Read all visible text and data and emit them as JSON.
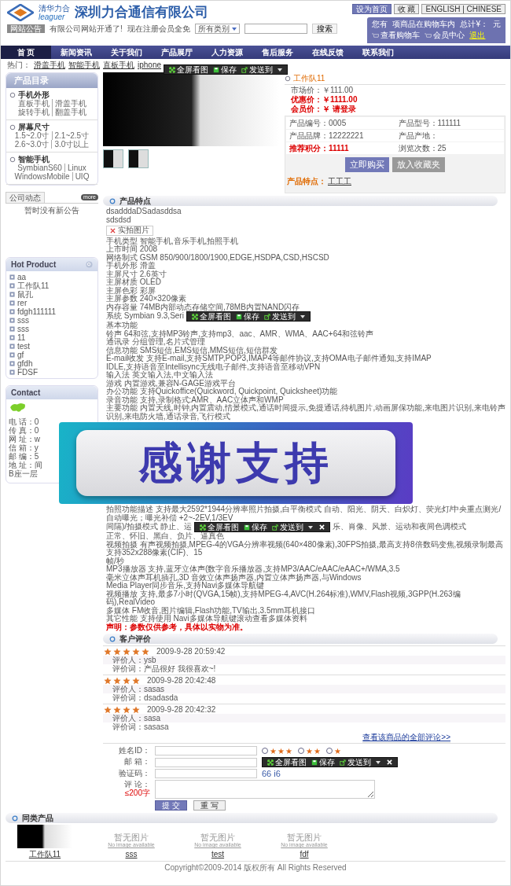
{
  "header": {
    "logo_cn": "清华力合",
    "logo_latin": "leaguer",
    "company_name": "深圳力合通信有限公司",
    "top_links": [
      "设为首页",
      "收 藏",
      "ENGLISH | CHINESE"
    ]
  },
  "notice_bar": {
    "tag": "网站公告",
    "notice": "有限公司网站开通了!",
    "register": "现在注册会员全免",
    "category_select": "所有类别",
    "search_button": "搜索"
  },
  "cart": {
    "text_before": "您有",
    "text_mid": "项商品在购物车内",
    "total_label": "总计¥：",
    "unit": "元",
    "links": [
      "查看购物车",
      "会员中心"
    ],
    "logout": "退出"
  },
  "nav": [
    {
      "label": "首 页",
      "selected": true
    },
    {
      "label": "新闻资讯",
      "selected": false
    },
    {
      "label": "关于我们",
      "selected": false
    },
    {
      "label": "产品展厅",
      "selected": false
    },
    {
      "label": "人力资源",
      "selected": false
    },
    {
      "label": "售后服务",
      "selected": false
    },
    {
      "label": "在线反馈",
      "selected": false
    },
    {
      "label": "联系我们",
      "selected": false
    }
  ],
  "hot": {
    "label": "热门：",
    "links": [
      "滑盖手机",
      "智能手机",
      "直板手机",
      "iphone"
    ]
  },
  "sidebar": {
    "catalog": {
      "title": "产品目录",
      "groups": [
        {
          "title": "手机外形",
          "lines": [
            [
              "直板手机",
              "滑盖手机"
            ],
            [
              "旋转手机",
              "翻盖手机"
            ]
          ]
        },
        {
          "title": "屏幕尺寸",
          "lines": [
            [
              "1.5~2.0寸",
              "2.1~2.5寸"
            ],
            [
              "2.6~3.0寸",
              "3.0寸以上"
            ]
          ]
        },
        {
          "title": "智能手机",
          "lines": [
            [
              "SymbianS60",
              "Linux"
            ],
            [
              "WindowsMobile",
              "UIQ"
            ]
          ]
        }
      ]
    },
    "news": {
      "tab": "公司动态",
      "more": "more",
      "empty": "暂时没有新公告"
    },
    "hot_products": {
      "title": "Hot Product",
      "items": [
        "aa",
        "工作队11",
        "鼠孔",
        "rer",
        "fdgh111111",
        "sss",
        "sss",
        "11",
        "test",
        "gf",
        "gfdh",
        "FDSF"
      ]
    },
    "contact": {
      "title": "Contact",
      "lines": [
        "电 话：0",
        "传 真：0",
        "网 址：w",
        "信 箱：y",
        "邮 编：5",
        "地 址：间",
        "B座一层"
      ]
    }
  },
  "product": {
    "name": "工作队11",
    "toolbar": {
      "buttons": [
        "全屏看图",
        "保存",
        "发送到"
      ],
      "closable": false
    },
    "prices": [
      {
        "label": "市场价：",
        "value": "￥111.00",
        "kind": "normal"
      },
      {
        "label": "优惠价：",
        "value": "￥1111.00",
        "kind": "highlight"
      },
      {
        "label": "会员价：",
        "value": "￥ 请登录",
        "kind": "highlight"
      }
    ],
    "specs": [
      [
        {
          "label": "产品编号：",
          "value": "0005",
          "kind": "normal"
        },
        {
          "label": "产品型号：",
          "value": "111111",
          "kind": "normal"
        }
      ],
      [
        {
          "label": "产品品牌：",
          "value": "12222221",
          "kind": "normal"
        },
        {
          "label": "产品产地：",
          "kind": "normal"
        }
      ],
      [
        {
          "label": "推荐积分：",
          "value": "11111",
          "kind": "highlight"
        },
        {
          "label": "浏览次数：",
          "value": "25",
          "kind": "normal"
        }
      ]
    ],
    "buttons": [
      "立即购买",
      "放入收藏夹"
    ],
    "feature_label": "产品特点：",
    "feature_value": "工工工"
  },
  "features": {
    "title": "产品特点",
    "intro": [
      "dsadddaDSadasddsa",
      "sdsdsd"
    ],
    "broken_image": "实拍图片",
    "rows": [
      [
        {
          "kind": "text",
          "text": "手机类型 智能手机,音乐手机,拍照手机"
        }
      ],
      [
        {
          "kind": "text",
          "text": "上市时间 2008"
        }
      ],
      [
        {
          "kind": "text",
          "text": "网络制式 GSM 850/900/1800/1900,EDGE,HSDPA,CSD,HSCSD"
        }
      ],
      [
        {
          "kind": "text",
          "text": "手机外形 滑盖"
        }
      ],
      [
        {
          "kind": "text",
          "text": "主屏尺寸 2.6英寸"
        }
      ],
      [
        {
          "kind": "text",
          "text": "主屏材质 OLED"
        }
      ],
      [
        {
          "kind": "text",
          "text": "主屏色彩 彩屏"
        }
      ],
      [
        {
          "kind": "text",
          "text": "主屏参数 240×320像素"
        }
      ],
      [
        {
          "kind": "text",
          "text": "内存容量 74MB内部动态存储空间,78MB内置NAND闪存"
        }
      ],
      [
        {
          "kind": "text",
          "text": "系统 Symbian 9.3,Seri"
        },
        {
          "kind": "toolbar",
          "buttons": [
            "全屏看图",
            "保存",
            "发送到"
          ],
          "closable": false
        }
      ],
      [
        {
          "kind": "text",
          "text": "基本功能"
        }
      ],
      [
        {
          "kind": "text",
          "text": "铃声 64和弦,支持MP3铃声,支持mp3、aac、AMR、WMA、AAC+64和弦铃声"
        }
      ],
      [
        {
          "kind": "text",
          "text": "通讯录 分组管理,名片式管理"
        }
      ],
      [
        {
          "kind": "text",
          "text": "信息功能 SMS短信,EMS短信,MMS短信,短信群发"
        }
      ],
      [
        {
          "kind": "text",
          "text": "E-mail收发 支持E-mail,支持SMTP,POP3,IMAP4等邮件协议,支持OMA电子邮件通知,支持IMAP"
        }
      ],
      [
        {
          "kind": "text",
          "text": "IDLE,支持语音至Intellisync无线电子邮件,支持语音至移动VPN"
        }
      ],
      [
        {
          "kind": "text",
          "text": "输入法 英文输入法,中文输入法"
        }
      ],
      [
        {
          "kind": "text",
          "text": "游戏 内置游戏,兼容N-GAGE游戏平台"
        }
      ],
      [
        {
          "kind": "text",
          "text": "办公功能 支持Quickoffice(Quickword, Quickpoint, Quicksheet)功能"
        }
      ],
      [
        {
          "kind": "text",
          "text": "录音功能 支持,录制格式:AMR、AAC立体声和WMP"
        }
      ],
      [
        {
          "kind": "text",
          "text": "主要功能 内置天线,时钟,内置震动,情景模式,通话时间提示,免提通话,待机图片,动画屏保功能,来电图片识别,来电铃声识别,来电防火墙,通话录音,飞行模式"
        }
      ]
    ],
    "banner": {
      "text": "感谢支持"
    },
    "rows_after": [
      [
        {
          "kind": "text",
          "text": "拍照功能描述 支持最大2592*1944分辨率照片拍摄,白平衡模式 自动、阳光、阴天、白炽灯、荧光灯/中央重点测光/自动曝光；曝光补偿 +2~-2EV,1/3EV"
        }
      ],
      [
        {
          "kind": "text",
          "text": "间隔)/拍摄模式 静止、运"
        },
        {
          "kind": "toolbar",
          "buttons": [
            "全屏看图",
            "保存",
            "发送到"
          ],
          "closable": true
        },
        {
          "kind": "text",
          "text": "乐、肖像、风景、运动和夜间色调模式"
        }
      ],
      [
        {
          "kind": "text",
          "text": "正常、怀旧、黑白、负片、逼真色"
        }
      ],
      [
        {
          "kind": "text",
          "text": "视频拍摄 有声视频拍摄,MPEG-4的VGA分辨率视频(640×480像素),30FPS拍摄,最高支持8倍数码变焦,视频录制最高支持352x288像素(CIF)、15"
        }
      ],
      [
        {
          "kind": "text",
          "text": "帧/秒"
        }
      ],
      [
        {
          "kind": "text",
          "text": "MP3播放器 支持,蓝牙立体声(数字音乐播放器,支持MP3/AAC/eAAC/eAAC+/WMA,3.5"
        }
      ],
      [
        {
          "kind": "text",
          "text": "毫米立体声耳机插孔,3D 音效立体声扬声器,内置立体声扬声器,与Windows"
        }
      ],
      [
        {
          "kind": "text",
          "text": "Media Player同步音乐,支持Navi多媒体导航键"
        }
      ],
      [
        {
          "kind": "text",
          "text": "视频播放 支持,最多7小时(QVGA,15帧),支持MPEG-4,AVC(H.264标准),WMV,Flash视频,3GPP(H.263编码),RealVideo"
        }
      ],
      [
        {
          "kind": "text",
          "text": "多媒体 FM收音,图片编辑,Flash功能,TV输出,3.5mm耳机接口"
        }
      ],
      [
        {
          "kind": "text",
          "text": "其它性能 支持使用 Navi多媒体导航键滚动查看多媒体资料"
        }
      ]
    ],
    "disclaimer": "声明：参数仅供参考，具体以实物为准。"
  },
  "reviews": {
    "title": "客户评价",
    "items": [
      {
        "stars": 5,
        "date": "2009-9-28 20:59:42",
        "reviewer_label": "评价人：",
        "reviewer": "ysb",
        "content_label": "评价词：",
        "content": "产品很好 我很喜欢~!"
      },
      {
        "stars": 4,
        "date": "2009-9-28 20:42:48",
        "reviewer_label": "评价人：",
        "reviewer": "sasas",
        "content_label": "评价词：",
        "content": "dsadasda"
      },
      {
        "stars": 4,
        "date": "2009-9-28 20:42:32",
        "reviewer_label": "评价人：",
        "reviewer": "sasa",
        "content_label": "评价词：",
        "content": "sasasa"
      }
    ],
    "all_link": "查看该商品的全部评论>>"
  },
  "review_form": {
    "fields": [
      {
        "label": "姓名ID：",
        "kind": "input"
      },
      {
        "label": "邮 箱：",
        "kind": "input"
      },
      {
        "label": "验证码：",
        "kind": "captcha",
        "captcha": "66 i6"
      },
      {
        "label": "评 论：",
        "kind": "textarea",
        "hint": "≤200字"
      }
    ],
    "ratings": [
      {
        "label": "★★★",
        "selected": false
      },
      {
        "label": "★★",
        "selected": false
      },
      {
        "label": "★",
        "selected": false
      }
    ],
    "toolbar": {
      "buttons": [
        "全屏看图",
        "保存",
        "发送到"
      ],
      "closable": true
    },
    "buttons": [
      "提 交",
      "重 写"
    ]
  },
  "related": {
    "title": "同类产品",
    "items": [
      {
        "name": "工作队11",
        "kind": "photo"
      },
      {
        "name": "sss",
        "kind": "no_image",
        "placeholder": "暂无图片",
        "placeholder_sub": "No image available"
      },
      {
        "name": "test",
        "kind": "no_image",
        "placeholder": "暂无图片",
        "placeholder_sub": "No image available"
      },
      {
        "name": "fdf",
        "kind": "no_image",
        "placeholder": "暂无图片",
        "placeholder_sub": "No image available"
      }
    ]
  },
  "footer": "Copyright©2009-2014 版权所有  All Rights Reserved"
}
